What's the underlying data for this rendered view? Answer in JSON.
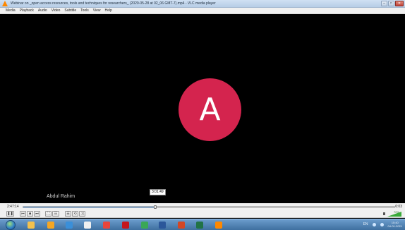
{
  "window": {
    "title": "Webinar on _open access resources, tools and techniques for researchers_ (2020-05-28 at 02_06 GMT-7).mp4 - VLC media player",
    "controls": {
      "minimize": "–",
      "maximize": "□",
      "close": "✕"
    }
  },
  "menu": [
    "Media",
    "Playback",
    "Audio",
    "Video",
    "Subtitle",
    "Tools",
    "View",
    "Help"
  ],
  "video": {
    "avatar_letter": "A",
    "avatar_color": "#d4244e",
    "speaker_name": "Abdul Rahim",
    "hover_time": "3:01:49"
  },
  "seek": {
    "elapsed": "2:47:14",
    "total": "6:03",
    "progress_fraction": 0.355
  },
  "controls": {
    "buttons": [
      "play-pause",
      "previous",
      "stop",
      "next",
      "fullscreen",
      "extended-settings",
      "playlist",
      "loop",
      "shuffle"
    ],
    "volume_label": "70%"
  },
  "taskbar": {
    "apps": [
      {
        "name": "file-explorer-icon",
        "color": "#f2c14e"
      },
      {
        "name": "paint-icon",
        "color": "#f5a623"
      },
      {
        "name": "internet-explorer-icon",
        "color": "#3a8fd9"
      },
      {
        "name": "media-player-icon",
        "color": "#f0f0f0"
      },
      {
        "name": "chrome-icon",
        "color": "#e8453c"
      },
      {
        "name": "acrobat-icon",
        "color": "#c4161c"
      },
      {
        "name": "chrome-2-icon",
        "color": "#3aa757"
      },
      {
        "name": "word-icon",
        "color": "#2b579a"
      },
      {
        "name": "powerpoint-icon",
        "color": "#d24726"
      },
      {
        "name": "excel-icon",
        "color": "#217346"
      },
      {
        "name": "vlc-icon",
        "color": "#ff8800"
      }
    ],
    "tray": {
      "language": "EN",
      "time": "15:40",
      "date": "04-01-2021"
    }
  }
}
